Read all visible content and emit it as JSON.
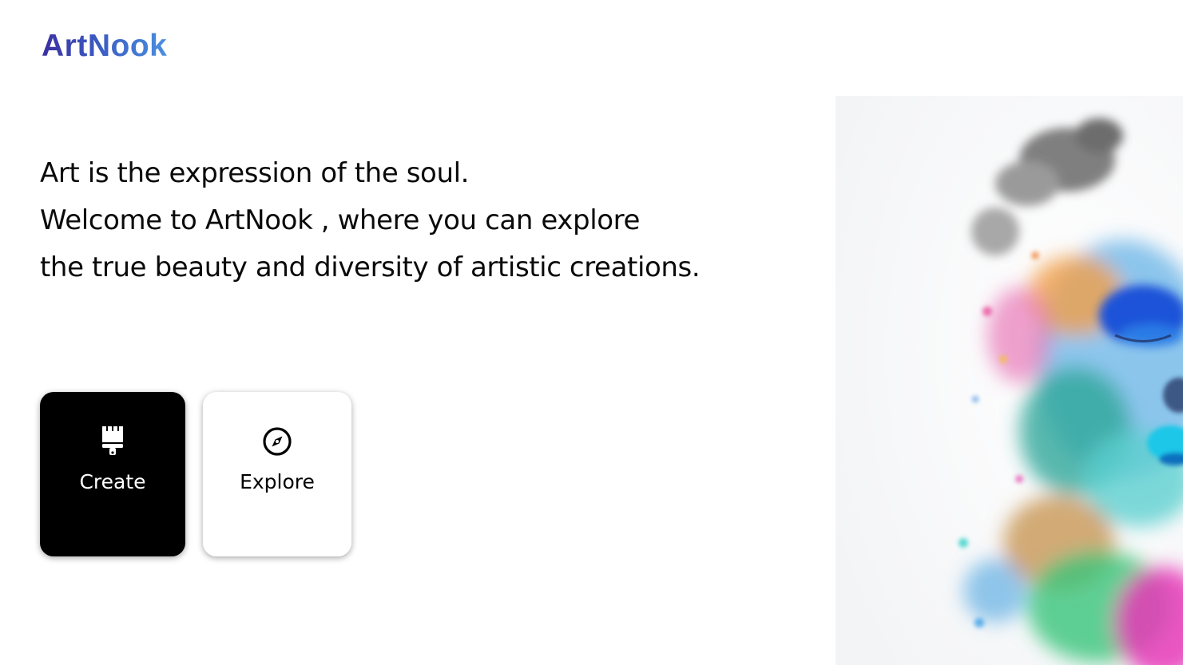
{
  "brand": {
    "name": "ArtNook"
  },
  "hero": {
    "line1": "Art is the expression of the soul.",
    "line2": "Welcome to ArtNook , where you can explore",
    "line3": "the true beauty and diversity of artistic creations."
  },
  "actions": {
    "create": {
      "label": "Create",
      "icon": "paintbrush-icon",
      "bg": "#000000"
    },
    "explore": {
      "label": "Explore",
      "icon": "compass-icon",
      "bg": "#ffffff"
    }
  },
  "colors": {
    "logo_start": "#3b2fa0",
    "logo_end": "#4b8fe0",
    "text": "#0a0a0a"
  },
  "artwork": {
    "subject": "colorful-powder-face-icon"
  }
}
